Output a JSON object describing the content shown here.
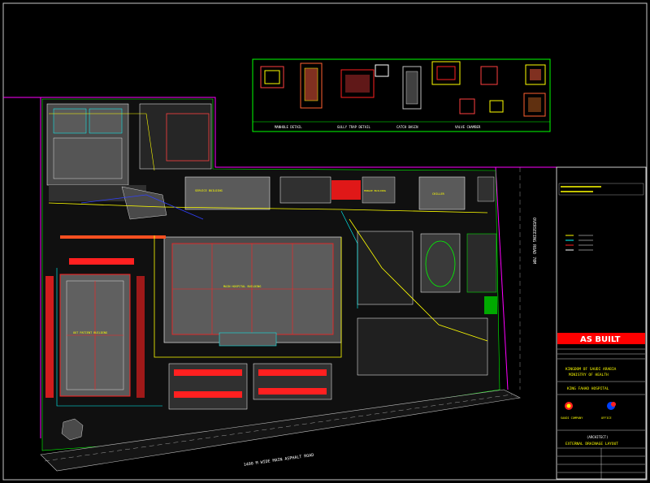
{
  "drawing": {
    "status_banner": "AS BUILT",
    "road_south": "1400 M WIDE MAIN ASPHALT ROAD",
    "road_east": "OVERSEEING ROAD 70M",
    "title_block": {
      "client_line1": "KINGDOM OF SAUDI ARABIA",
      "client_line2": "MINISTRY OF HEALTH",
      "project": "KING FAHAD HOSPITAL",
      "contractor": "SAUDI COMPANY",
      "consultant": "OFFICE",
      "section": "(ARCHITECT)",
      "sheet_title": "EXTERNAL DRAINAGE LAYOUT"
    },
    "buildings": {
      "main": "MAIN HOSPITAL BUILDING",
      "west": "OUT PATIENT BUILDING",
      "north_a": "SERVICE BUILDING",
      "north_b": "MORGUE BUILDING",
      "north_c": "CHILLER"
    },
    "details_sheet": {
      "caption_1": "MANHOLE DETAIL",
      "caption_2": "GULLY TRAP DETAIL",
      "caption_3": "CATCH BASIN",
      "caption_4": "VALVE CHAMBER"
    }
  }
}
